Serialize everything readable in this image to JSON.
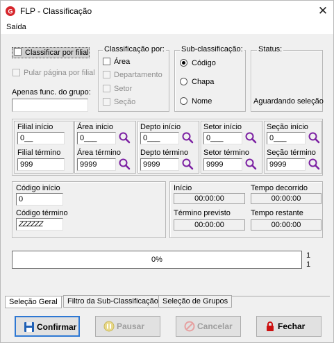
{
  "window": {
    "title": "FLP - Classificação",
    "close_glyph": "✕"
  },
  "menu": {
    "saida": "Saída"
  },
  "options": {
    "classificar_por_filial": "Classificar por filial",
    "pular_pagina": "Pular página por filial",
    "apenas_func_label": "Apenas func. do grupo:",
    "apenas_func_value": ""
  },
  "classificacao": {
    "label": "Classificação  por:",
    "items": [
      "Área",
      "Departamento",
      "Setor",
      "Seção"
    ]
  },
  "subclassificacao": {
    "label": "Sub-classificação:",
    "items": [
      "Código",
      "Chapa",
      "Nome"
    ],
    "selected": "Código"
  },
  "status": {
    "label": "Status:",
    "value": "Aguardando seleção"
  },
  "ranges": [
    {
      "start_label": "Filial início",
      "start_value": "0__",
      "end_label": "Filial término",
      "end_value": "999"
    },
    {
      "start_label": "Área início",
      "start_value": "0___",
      "end_label": "Área término",
      "end_value": "9999"
    },
    {
      "start_label": "Depto início",
      "start_value": "0___",
      "end_label": "Depto término",
      "end_value": "9999"
    },
    {
      "start_label": "Setor início",
      "start_value": "0___",
      "end_label": "Setor término",
      "end_value": "9999"
    },
    {
      "start_label": "Seção início",
      "start_value": "0___",
      "end_label": "Seção término",
      "end_value": "9999"
    }
  ],
  "codigo": {
    "start_label": "Código início",
    "start_value": "0",
    "end_label": "Código término",
    "end_value": "ZZZZZZ"
  },
  "timing": {
    "inicio_label": "Início",
    "inicio_value": "00:00:00",
    "decorrido_label": "Tempo decorrido",
    "decorrido_value": "00:00:00",
    "previsto_label": "Término previsto",
    "previsto_value": "00:00:00",
    "restante_label": "Tempo restante",
    "restante_value": "00:00:00"
  },
  "progress": {
    "text": "0%",
    "value": 0,
    "count_top": "1",
    "count_bottom": "1"
  },
  "tabs": [
    "Seleção Geral",
    "Filtro da Sub-Classificação",
    "Seleção de Grupos"
  ],
  "buttons": {
    "confirmar": "Confirmar",
    "pausar": "Pausar",
    "cancelar": "Cancelar",
    "fechar": "Fechar"
  },
  "colors": {
    "accent": "#2e78d3",
    "search_icon": "#7b1fa2",
    "close_red": "#cc1111"
  }
}
